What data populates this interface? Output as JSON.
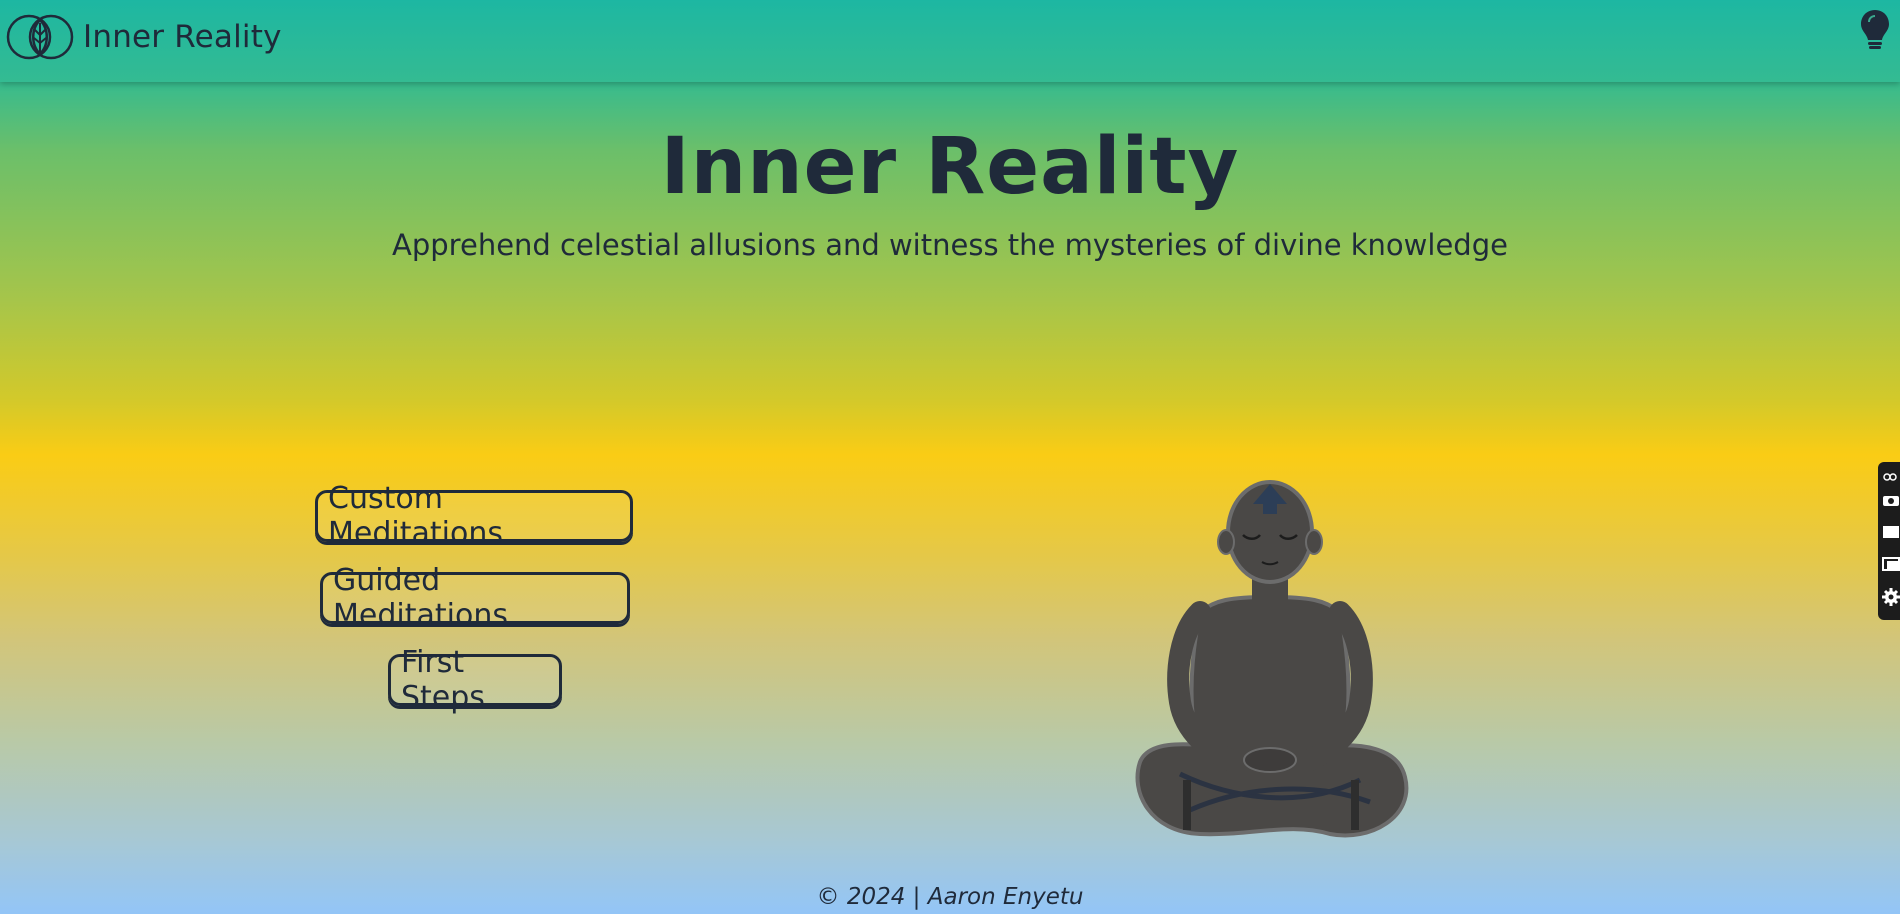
{
  "header": {
    "brand": "Inner Reality"
  },
  "hero": {
    "title": "Inner Reality",
    "subtitle": "Apprehend celestial allusions and witness the mysteries of divine knowledge"
  },
  "buttons": {
    "custom": "Custom Meditations",
    "guided": "Guided Meditations",
    "first_steps": "First Steps"
  },
  "footer": {
    "text": "© 2024 | Aaron Enyetu"
  },
  "icons": {
    "logo": "leaf-logo-icon",
    "theme": "lightbulb-icon",
    "figure": "meditating-figure-image"
  },
  "colors": {
    "text": "#1f2a3a",
    "header": "#1db7a2",
    "mid": "#facc15",
    "bottom": "#93c5f7"
  }
}
